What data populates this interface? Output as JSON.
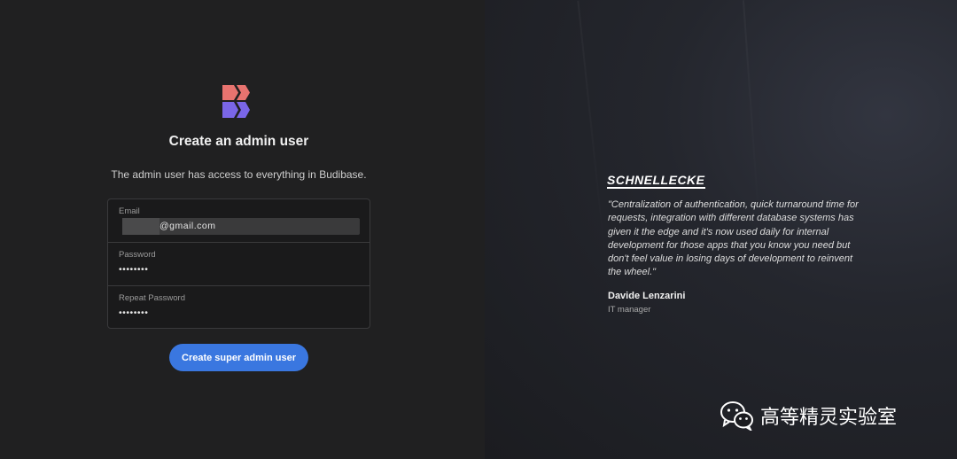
{
  "auth": {
    "title": "Create an admin user",
    "subtitle": "The admin user has access to everything in Budibase.",
    "email_label": "Email",
    "email_value": "@gmail.com",
    "password_label": "Password",
    "password_value": "••••••••",
    "repeat_label": "Repeat Password",
    "repeat_value": "••••••••",
    "submit_label": "Create super admin user"
  },
  "testimonial": {
    "brand": "SCHNELLECKE",
    "quote": "\"Centralization of authentication, quick turnaround time for requests, integration with different database systems has given it the edge and it's now used daily for internal development for those apps that you know you need but don't feel value in losing days of development to reinvent the wheel.\"",
    "author": "Davide Lenzarini",
    "role": "IT manager"
  },
  "watermark": {
    "text": "高等精灵实验室",
    "icon": "wechat-icon"
  },
  "colors": {
    "accent": "#3a77e0",
    "logo_top": "#e8736f",
    "logo_bottom": "#7a66e8"
  }
}
